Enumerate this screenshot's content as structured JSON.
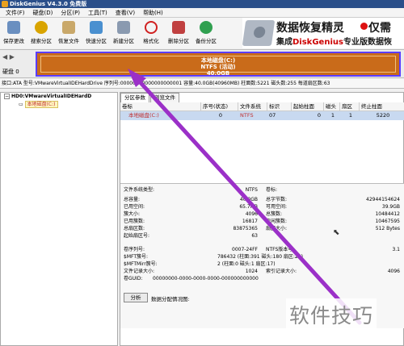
{
  "window": {
    "title": "DiskGenius V4.3.0 免费版"
  },
  "menu": [
    "文件(F)",
    "硬盘(D)",
    "分区(P)",
    "工具(T)",
    "查看(V)",
    "帮助(H)"
  ],
  "toolbar": [
    {
      "label": "保存更改",
      "icon": "save-icon",
      "color": "#6a8fc0"
    },
    {
      "label": "搜索分区",
      "icon": "search-partition-icon",
      "color": "#d9a400"
    },
    {
      "label": "恢复文件",
      "icon": "recover-file-icon",
      "color": "#c9a86a"
    },
    {
      "label": "快速分区",
      "icon": "quick-partition-icon",
      "color": "#4a90d0"
    },
    {
      "label": "新建分区",
      "icon": "new-partition-icon",
      "color": "#8a9ab0"
    },
    {
      "label": "格式化",
      "icon": "format-icon",
      "color": "#d02020"
    },
    {
      "label": "删除分区",
      "icon": "delete-partition-icon",
      "color": "#c04040"
    },
    {
      "label": "备份分区",
      "icon": "backup-partition-icon",
      "color": "#30a050"
    }
  ],
  "banner": {
    "title": "数据恢复精灵",
    "subtitle_pre": "集成",
    "subtitle_brand": "DiskGenius",
    "subtitle_post": "专业版数据恢",
    "ad": "仅需"
  },
  "diskmap": {
    "disk_label": "硬盘 0",
    "partition_name": "本地磁盘(C:)",
    "partition_fs": "NTFS (活动)",
    "partition_size": "40.0GB"
  },
  "infobar": {
    "text": "接口:ATA  型号:VMwareVirtualIDEHardDrive  序列号:00000000000000000001  容量:40.0GB(40960MB)  柱面数:5221  磁头数:255  每道扇区数:63"
  },
  "tree": {
    "disk": "HD0:VMwareVirtualIDEHardD",
    "partition": "本地磁盘(C:)"
  },
  "tabs": [
    "分区参数",
    "浏览文件"
  ],
  "table": {
    "headers": [
      "卷标",
      "序号(状态)",
      "文件系统",
      "标识",
      "起始柱面",
      "磁头",
      "扇区",
      "终止柱面"
    ],
    "rows": [
      {
        "label": "本地磁盘(C:)",
        "num": "0",
        "fs": "NTFS",
        "id": "07",
        "start_cyl": "0",
        "head": "1",
        "sector": "1",
        "end_cyl": "5220"
      }
    ]
  },
  "details": {
    "fs_type_label": "文件系统类型:",
    "fs_type": "NTFS",
    "vol_label": "卷标:",
    "total_cap_label": "总容量:",
    "total_cap": "40.0GB",
    "total_bytes_label": "总字节数:",
    "total_bytes": "42944154624",
    "used_label": "已用空间:",
    "used": "65.7MB",
    "free_label": "可用空间:",
    "free": "39.9GB",
    "cluster_label": "簇大小:",
    "cluster": "4096",
    "total_clusters_label": "总簇数:",
    "total_clusters": "10484412",
    "used_clusters_label": "已用簇数:",
    "used_clusters": "16817",
    "free_clusters_label": "空闲簇数:",
    "free_clusters": "10467595",
    "total_sectors_label": "总扇区数:",
    "total_sectors": "83875365",
    "sector_size_label": "扇区大小:",
    "sector_size": "512 Bytes",
    "start_sector_label": "起始扇区号:",
    "start_sector": "63",
    "serial_label": "卷序列号:",
    "serial": "0007-24FF",
    "ntfs_ver_label": "NTFS版本号:",
    "ntfs_ver": "3.1",
    "mft_label": "$MFT簇号:",
    "mft": "786432 (柱面:391 磁头:180 扇区:25)",
    "mftmirr_label": "$MFTMirr簇号:",
    "mftmirr": "2 (柱面:0 磁头:1 扇区:17)",
    "rec_size_label": "文件记录大小:",
    "rec_size": "1024",
    "idx_size_label": "索引记录大小:",
    "idx_size": "4096",
    "guid_label": "卷GUID:",
    "guid": "00000000-0000-0000-0000-000000000000"
  },
  "analyze_button": "分析",
  "analyze_label": "数据分配情况图:",
  "watermark": "软件技巧"
}
